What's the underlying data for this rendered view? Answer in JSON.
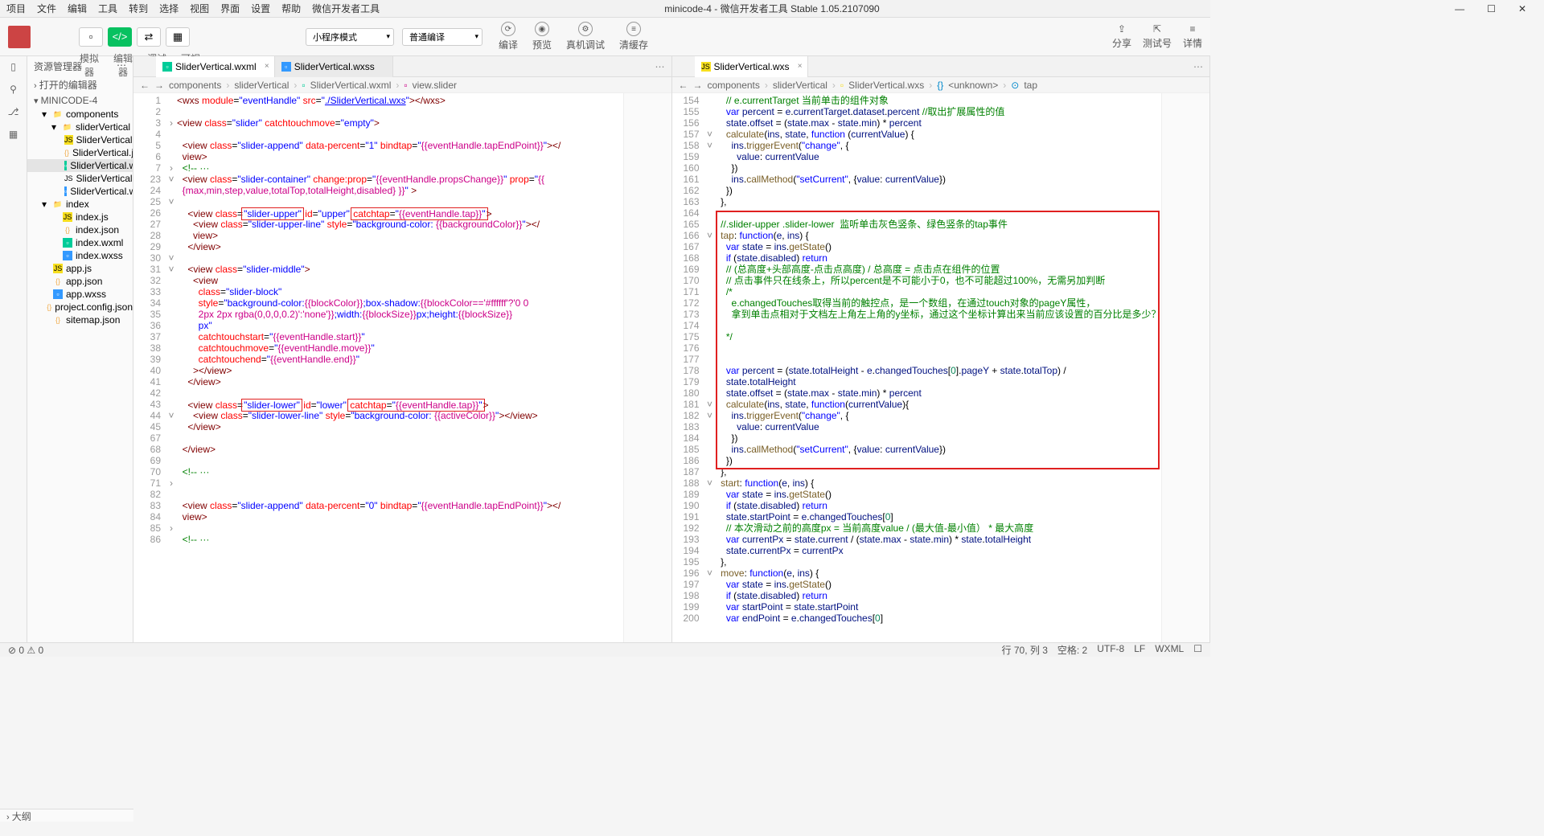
{
  "title": "minicode-4 - 微信开发者工具 Stable 1.05.2107090",
  "menu": [
    "项目",
    "文件",
    "编辑",
    "工具",
    "转到",
    "选择",
    "视图",
    "界面",
    "设置",
    "帮助",
    "微信开发者工具"
  ],
  "win": [
    "—",
    "☐",
    "✕"
  ],
  "toolbar": {
    "modes": [
      "模拟器",
      "编辑器",
      "调试器",
      "可视化"
    ],
    "dd1": "小程序模式",
    "dd2": "普通编译",
    "actions": [
      "编译",
      "预览",
      "真机调试",
      "清缓存"
    ],
    "right": [
      "分享",
      "测试号",
      "详情"
    ],
    "rightIcons": [
      "⇪",
      "⇱",
      "≡"
    ]
  },
  "sidebar": {
    "title": "资源管理器",
    "open": "打开的编辑器",
    "project": "MINICODE-4",
    "tree": [
      {
        "l": 1,
        "t": "fold",
        "n": "components",
        "exp": "▾"
      },
      {
        "l": 2,
        "t": "fold",
        "n": "sliderVertical",
        "exp": "▾"
      },
      {
        "l": 3,
        "t": "js",
        "n": "SliderVertical.js"
      },
      {
        "l": 3,
        "t": "json",
        "n": "SliderVertical.json"
      },
      {
        "l": 3,
        "t": "wxml",
        "n": "SliderVertical.wxml",
        "sel": true
      },
      {
        "l": 3,
        "t": "wxs",
        "n": "SliderVertical.wxs"
      },
      {
        "l": 3,
        "t": "wxss",
        "n": "SliderVertical.wxss"
      },
      {
        "l": 1,
        "t": "fold",
        "n": "index",
        "exp": "▾"
      },
      {
        "l": 2,
        "t": "js",
        "n": "index.js"
      },
      {
        "l": 2,
        "t": "json",
        "n": "index.json"
      },
      {
        "l": 2,
        "t": "wxml",
        "n": "index.wxml"
      },
      {
        "l": 2,
        "t": "wxss",
        "n": "index.wxss"
      },
      {
        "l": 1,
        "t": "js",
        "n": "app.js"
      },
      {
        "l": 1,
        "t": "json",
        "n": "app.json"
      },
      {
        "l": 1,
        "t": "wxss",
        "n": "app.wxss"
      },
      {
        "l": 1,
        "t": "json",
        "n": "project.config.json"
      },
      {
        "l": 1,
        "t": "json",
        "n": "sitemap.json"
      }
    ],
    "outline": "大纲",
    "errors": "⊘ 0 ⚠ 0"
  },
  "leftPane": {
    "tabs": [
      {
        "name": "SliderVertical.wxml",
        "icon": "wxml",
        "active": true
      },
      {
        "name": "SliderVertical.wxss",
        "icon": "wxss",
        "active": false
      }
    ],
    "crumbs": [
      "components",
      "sliderVertical",
      "SliderVertical.wxml",
      "view.slider"
    ],
    "lines": [
      1,
      2,
      3,
      4,
      5,
      6,
      7,
      23,
      24,
      25,
      26,
      27,
      28,
      29,
      30,
      31,
      32,
      33,
      34,
      35,
      36,
      37,
      38,
      39,
      40,
      41,
      42,
      43,
      44,
      45,
      67,
      68,
      69,
      70,
      71,
      82,
      83,
      84,
      85,
      86
    ]
  },
  "rightPane": {
    "tabs": [
      {
        "name": "SliderVertical.wxs",
        "icon": "wxs",
        "active": true
      }
    ],
    "crumbs": [
      "components",
      "sliderVertical",
      "SliderVertical.wxs",
      "<unknown>",
      "tap"
    ],
    "lines": [
      154,
      155,
      156,
      157,
      158,
      159,
      160,
      161,
      162,
      163,
      164,
      165,
      166,
      167,
      168,
      169,
      170,
      171,
      172,
      173,
      174,
      175,
      176,
      177,
      178,
      179,
      180,
      181,
      182,
      183,
      184,
      185,
      186,
      187,
      188,
      189,
      190,
      191,
      192,
      193,
      194,
      195,
      196,
      197,
      198,
      199,
      200
    ]
  },
  "status": {
    "left": "",
    "items": [
      "行 70, 列 3",
      "空格: 2",
      "UTF-8",
      "LF",
      "WXML",
      "☐"
    ]
  }
}
